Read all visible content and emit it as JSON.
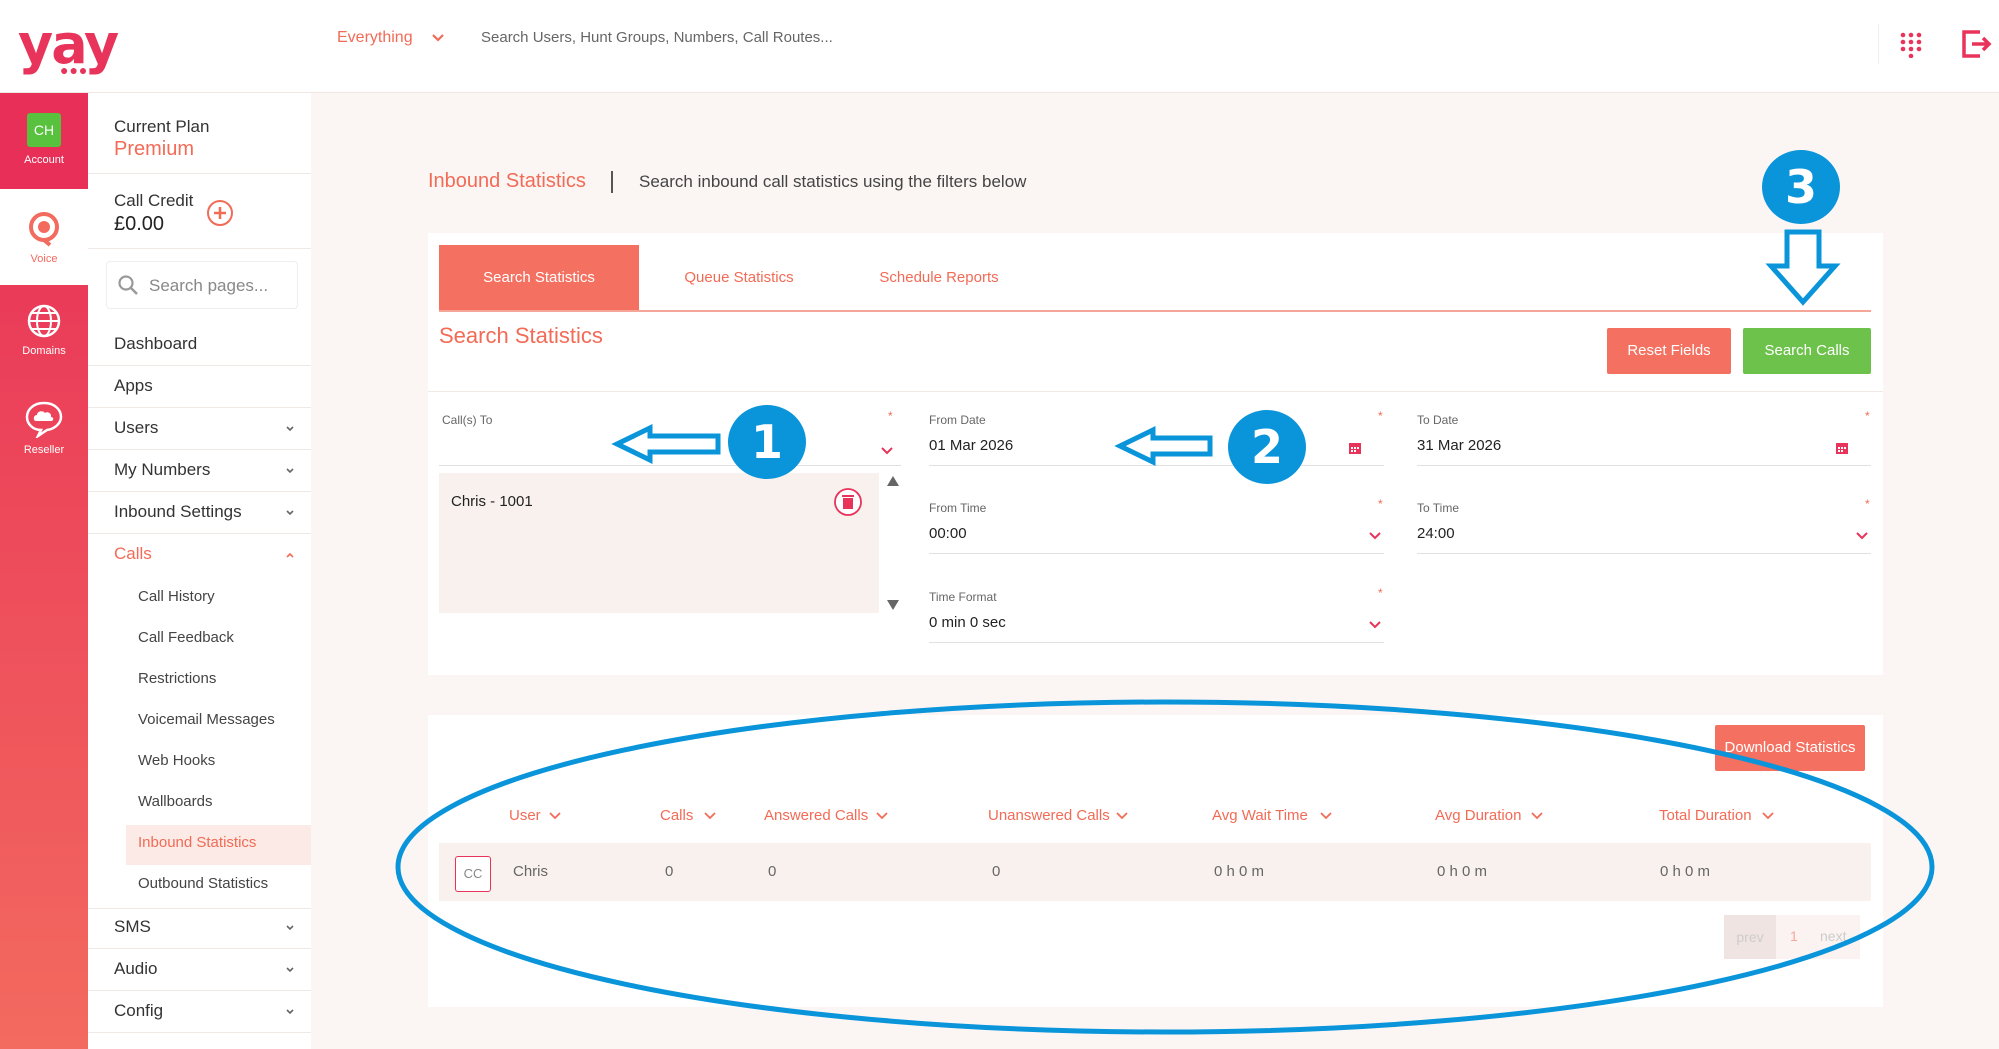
{
  "header": {
    "logo": "yay",
    "logo_dots": "●●●",
    "scope": "Everything",
    "search_placeholder": "Search Users, Hunt Groups, Numbers, Call Routes..."
  },
  "rail": {
    "account_initials": "CH",
    "account": "Account",
    "voice": "Voice",
    "domains": "Domains",
    "reseller": "Reseller"
  },
  "nav": {
    "plan_label": "Current Plan",
    "plan_value": "Premium",
    "credit_label": "Call Credit",
    "credit_value": "£0.00",
    "search_placeholder": "Search pages...",
    "items": {
      "dashboard": "Dashboard",
      "apps": "Apps",
      "users": "Users",
      "my_numbers": "My Numbers",
      "inbound_settings": "Inbound Settings",
      "calls": "Calls",
      "sms": "SMS",
      "audio": "Audio",
      "config": "Config"
    },
    "calls_sub": {
      "call_history": "Call History",
      "call_feedback": "Call Feedback",
      "restrictions": "Restrictions",
      "voicemail": "Voicemail Messages",
      "web_hooks": "Web Hooks",
      "wallboards": "Wallboards",
      "inbound_statistics": "Inbound Statistics",
      "outbound_statistics": "Outbound Statistics"
    }
  },
  "page": {
    "title": "Inbound Statistics",
    "description": "Search inbound call statistics using the filters below"
  },
  "tabs": {
    "search": "Search Statistics",
    "queue": "Queue Statistics",
    "schedule": "Schedule Reports"
  },
  "form": {
    "section_title": "Search Statistics",
    "reset_label": "Reset Fields",
    "search_label": "Search Calls",
    "calls_to_label": "Call(s) To",
    "required": "*",
    "selected_user": "Chris - 1001",
    "from_date_label": "From Date",
    "from_date": "01 Mar 2026",
    "to_date_label": "To Date",
    "to_date": "31 Mar 2026",
    "from_time_label": "From Time",
    "from_time": "00:00",
    "to_time_label": "To Time",
    "to_time": "24:00",
    "time_format_label": "Time Format",
    "time_format": "0 min 0 sec"
  },
  "results": {
    "download_label": "Download Statistics",
    "columns": {
      "user": "User",
      "calls": "Calls",
      "answered": "Answered Calls",
      "unanswered": "Unanswered Calls",
      "avg_wait": "Avg Wait Time",
      "avg_duration": "Avg Duration",
      "total_duration": "Total Duration"
    },
    "row": {
      "avatar": "CC",
      "user": "Chris",
      "calls": "0",
      "answered": "0",
      "unanswered": "0",
      "avg_wait": "0 h 0 m",
      "avg_duration": "0 h 0 m",
      "total_duration": "0 h 0 m"
    },
    "pager": {
      "prev": "prev",
      "page": "1",
      "next": "next"
    }
  },
  "annotations": {
    "one": "1",
    "two": "2",
    "three": "3"
  },
  "colors": {
    "brand": "#e8335a",
    "accent": "#f47060",
    "success": "#6cc24a",
    "annotation": "#0a94da"
  }
}
